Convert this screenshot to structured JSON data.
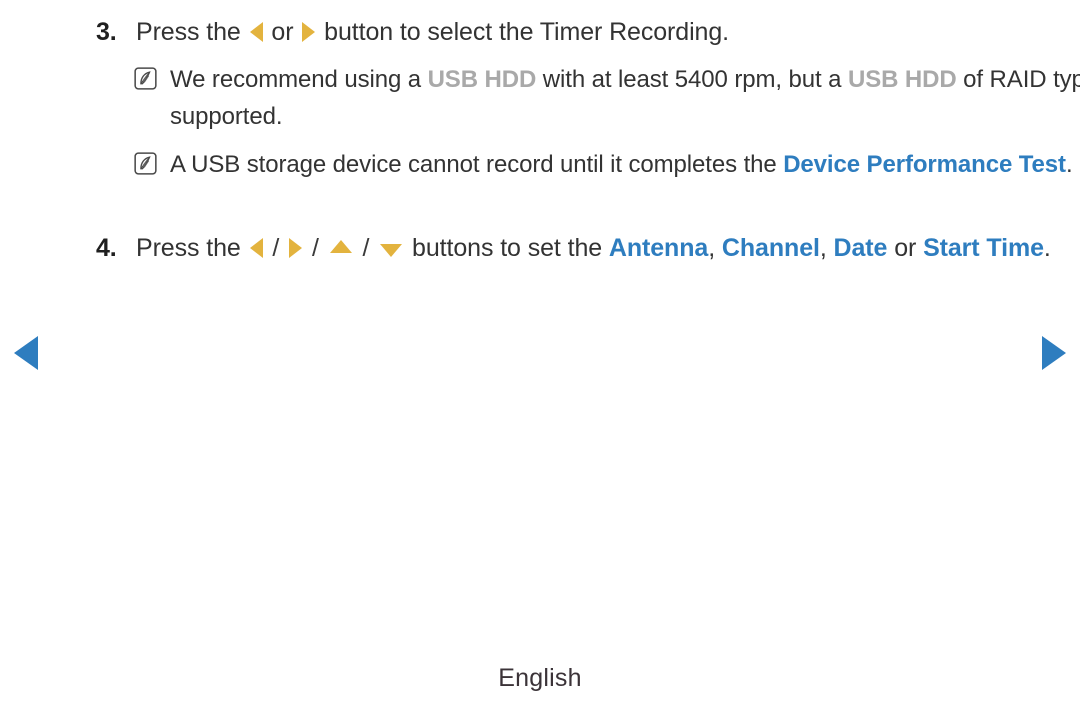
{
  "page": {
    "background_color": "#ffffff",
    "body_text_color": "#333333",
    "accent_blue": "#2e7dbf",
    "accent_gold": "#e3b33e",
    "muted_gray": "#a9a9a9"
  },
  "steps": [
    {
      "number": "3.",
      "parts": [
        {
          "type": "text",
          "value": "Press the "
        },
        {
          "type": "icon",
          "icon": "arrow-left-icon"
        },
        {
          "type": "text",
          "value": " or "
        },
        {
          "type": "icon",
          "icon": "arrow-right-icon"
        },
        {
          "type": "text",
          "value": " button to select the Timer Recording."
        }
      ],
      "plain": "Press the ◀ or ▶ button to select the Timer Recording."
    },
    {
      "number": "4.",
      "parts": [
        {
          "type": "text",
          "value": "Press the "
        },
        {
          "type": "icon",
          "icon": "arrow-left-icon"
        },
        {
          "type": "text",
          "value": " / "
        },
        {
          "type": "icon",
          "icon": "arrow-right-icon"
        },
        {
          "type": "text",
          "value": " / "
        },
        {
          "type": "icon",
          "icon": "arrow-up-icon"
        },
        {
          "type": "text",
          "value": " / "
        },
        {
          "type": "icon",
          "icon": "arrow-down-icon"
        },
        {
          "type": "text",
          "value": " buttons to set the "
        },
        {
          "type": "keyword-blue",
          "value": "Antenna"
        },
        {
          "type": "text",
          "value": ", "
        },
        {
          "type": "keyword-blue",
          "value": "Channel"
        },
        {
          "type": "text",
          "value": ", "
        },
        {
          "type": "keyword-blue",
          "value": "Date"
        },
        {
          "type": "text",
          "value": " or "
        },
        {
          "type": "keyword-blue",
          "value": "Start Time"
        },
        {
          "type": "text",
          "value": "."
        }
      ],
      "plain": "Press the ◀ / ▶ / ▲ / ▼ buttons to set the Antenna, Channel, Date or Start Time."
    }
  ],
  "notes": [
    {
      "icon": "note-icon",
      "segments": [
        {
          "type": "text",
          "value": "We recommend using a "
        },
        {
          "type": "keyword-gray",
          "value": "USB HDD"
        },
        {
          "type": "text",
          "value": " with at least 5400 rpm, but a "
        },
        {
          "type": "keyword-gray",
          "value": "USB HDD"
        },
        {
          "type": "text",
          "value": " of RAID type is not supported."
        }
      ],
      "plain": "We recommend using a USB HDD with at least 5400 rpm, but a USB HDD of RAID type is not supported."
    },
    {
      "icon": "note-icon",
      "segments": [
        {
          "type": "text",
          "value": "A USB storage device cannot record until it completes the "
        },
        {
          "type": "keyword-blue",
          "value": "Device Performance Test"
        },
        {
          "type": "text",
          "value": "."
        }
      ],
      "plain": "A USB storage device cannot record until it completes the Device Performance Test."
    }
  ],
  "nav": {
    "prev_label": "Previous page",
    "prev_icon": "triangle-left-icon",
    "next_label": "Next page",
    "next_icon": "triangle-right-icon"
  },
  "footer": {
    "language": "English"
  },
  "fragments": {
    "step3_a": "Press the ",
    "step3_b": " or ",
    "step3_c": " button to select the Timer Recording.",
    "step4_a": "Press the ",
    "step4_slash": " / ",
    "step4_b": " buttons to set the ",
    "antenna": "Antenna",
    "comma": ", ",
    "channel": "Channel",
    "date": "Date",
    "or": " or ",
    "start_time": "Start Time",
    "period": ".",
    "note1_a": "We recommend using a ",
    "usb_hdd": "USB HDD",
    "note1_b": " with at least 5400 rpm, but a ",
    "note1_c": " of RAID type is not supported.",
    "note2_a": "A USB storage device cannot record until it completes the ",
    "device_perf_test": "Device Performance Test",
    "note2_b": "."
  }
}
